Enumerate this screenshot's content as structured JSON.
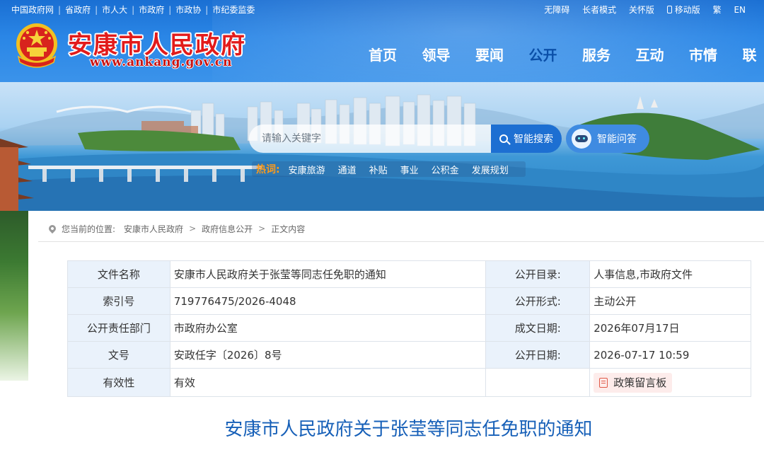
{
  "top_links": [
    "中国政府网",
    "省政府",
    "市人大",
    "市政府",
    "市政协",
    "市纪委监委"
  ],
  "util_links": {
    "accessible": "无障碍",
    "elder_mode": "长者模式",
    "care": "关怀版",
    "mobile": "移动版",
    "traditional": "繁",
    "english": "EN"
  },
  "site": {
    "name": "安康市人民政府",
    "url": "www.ankang.gov.cn"
  },
  "nav": [
    {
      "label": "首页",
      "active": false
    },
    {
      "label": "领导",
      "active": false
    },
    {
      "label": "要闻",
      "active": false
    },
    {
      "label": "公开",
      "active": true
    },
    {
      "label": "服务",
      "active": false
    },
    {
      "label": "互动",
      "active": false
    },
    {
      "label": "市情",
      "active": false
    },
    {
      "label": "联",
      "active": false
    }
  ],
  "search": {
    "placeholder": "请输入关键字",
    "button": "智能搜索",
    "qa_button": "智能问答"
  },
  "hot": {
    "label": "热词:",
    "words": [
      "安康旅游",
      "通道",
      "补贴",
      "事业",
      "公积金",
      "发展规划"
    ]
  },
  "breadcrumb": {
    "prefix": "您当前的位置:",
    "items": [
      "安康市人民政府",
      "政府信息公开",
      "正文内容"
    ],
    "separator": ">"
  },
  "meta_table": {
    "rows": [
      {
        "k1": "文件名称",
        "v1": "安康市人民政府关于张莹等同志任免职的通知",
        "k2": "公开目录:",
        "v2": "人事信息,市政府文件"
      },
      {
        "k1": "索引号",
        "v1": "719776475/2026-4048",
        "k2": "公开形式:",
        "v2": "主动公开"
      },
      {
        "k1": "公开责任部门",
        "v1": "市政府办公室",
        "k2": "成文日期:",
        "v2": "2026年07月17日"
      },
      {
        "k1": "文号",
        "v1": "安政任字〔2026〕8号",
        "k2": "公开日期:",
        "v2": "2026-07-17 10:59"
      },
      {
        "k1": "有效性",
        "v1": "有效",
        "k2": "",
        "v2": ""
      }
    ],
    "message_button": "政策留言板"
  },
  "document_title": "安康市人民政府关于张莹等同志任免职的通知",
  "colors": {
    "header_blue": "#1d74da",
    "nav_active": "#0a4fa8",
    "site_name_red": "#e21b1b",
    "search_button": "#1d6fd2",
    "hot_label": "#ff9b1a",
    "table_key_bg": "#eaf2fb",
    "title_blue": "#1760b8"
  }
}
